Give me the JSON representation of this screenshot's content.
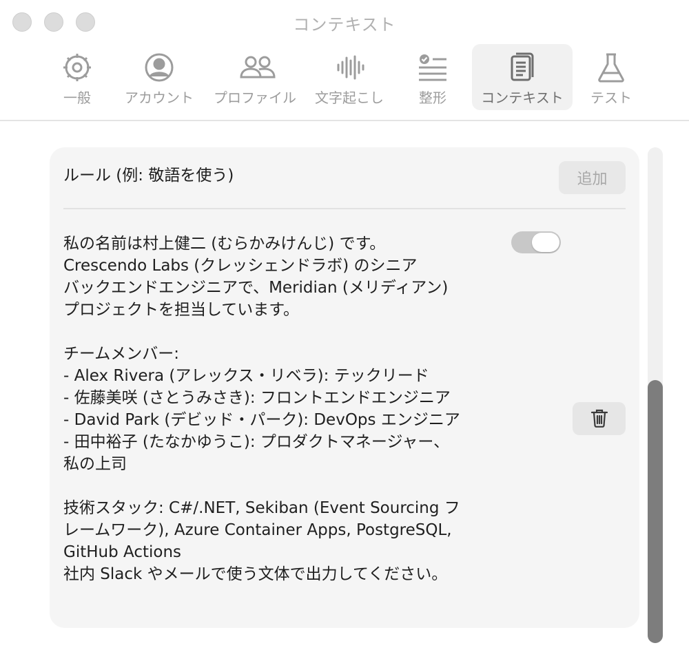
{
  "window": {
    "title": "コンテキスト"
  },
  "tabs": [
    {
      "id": "general",
      "label": "一般",
      "icon": "gear-icon"
    },
    {
      "id": "account",
      "label": "アカウント",
      "icon": "person-circle-icon"
    },
    {
      "id": "profile",
      "label": "プロファイル",
      "icon": "people-icon"
    },
    {
      "id": "transcription",
      "label": "文字起こし",
      "icon": "waveform-icon"
    },
    {
      "id": "formatting",
      "label": "整形",
      "icon": "checklist-icon"
    },
    {
      "id": "context",
      "label": "コンテキスト",
      "icon": "document-icon",
      "active": true
    },
    {
      "id": "test",
      "label": "テスト",
      "icon": "flask-icon"
    }
  ],
  "rule": {
    "placeholder": "ルール (例: 敬語を使う)",
    "add_label": "追加"
  },
  "context_entry": {
    "enabled": true,
    "text": "私の名前は村上健二 (むらかみけんじ) です。\nCrescendo Labs (クレッシェンドラボ) のシニア\nバックエンドエンジニアで、Meridian (メリディアン)\nプロジェクトを担当しています。\n\nチームメンバー:\n- Alex Rivera (アレックス・リベラ): テックリード\n- 佐藤美咲 (さとうみさき): フロントエンドエンジニア\n- David Park (デビッド・パーク): DevOps エンジニア\n- 田中裕子 (たなかゆうこ): プロダクトマネージャー、\n私の上司\n\n技術スタック: C#/.NET, Sekiban (Event Sourcing フ\nレームワーク), Azure Container Apps, PostgreSQL,\nGitHub Actions\n社内 Slack やメールで使う文体で出力してください。"
  },
  "colors": {
    "active_tab_bg": "#f1f1f1",
    "panel_bg": "#f5f5f5",
    "scroll_thumb": "#7d7d7d"
  }
}
